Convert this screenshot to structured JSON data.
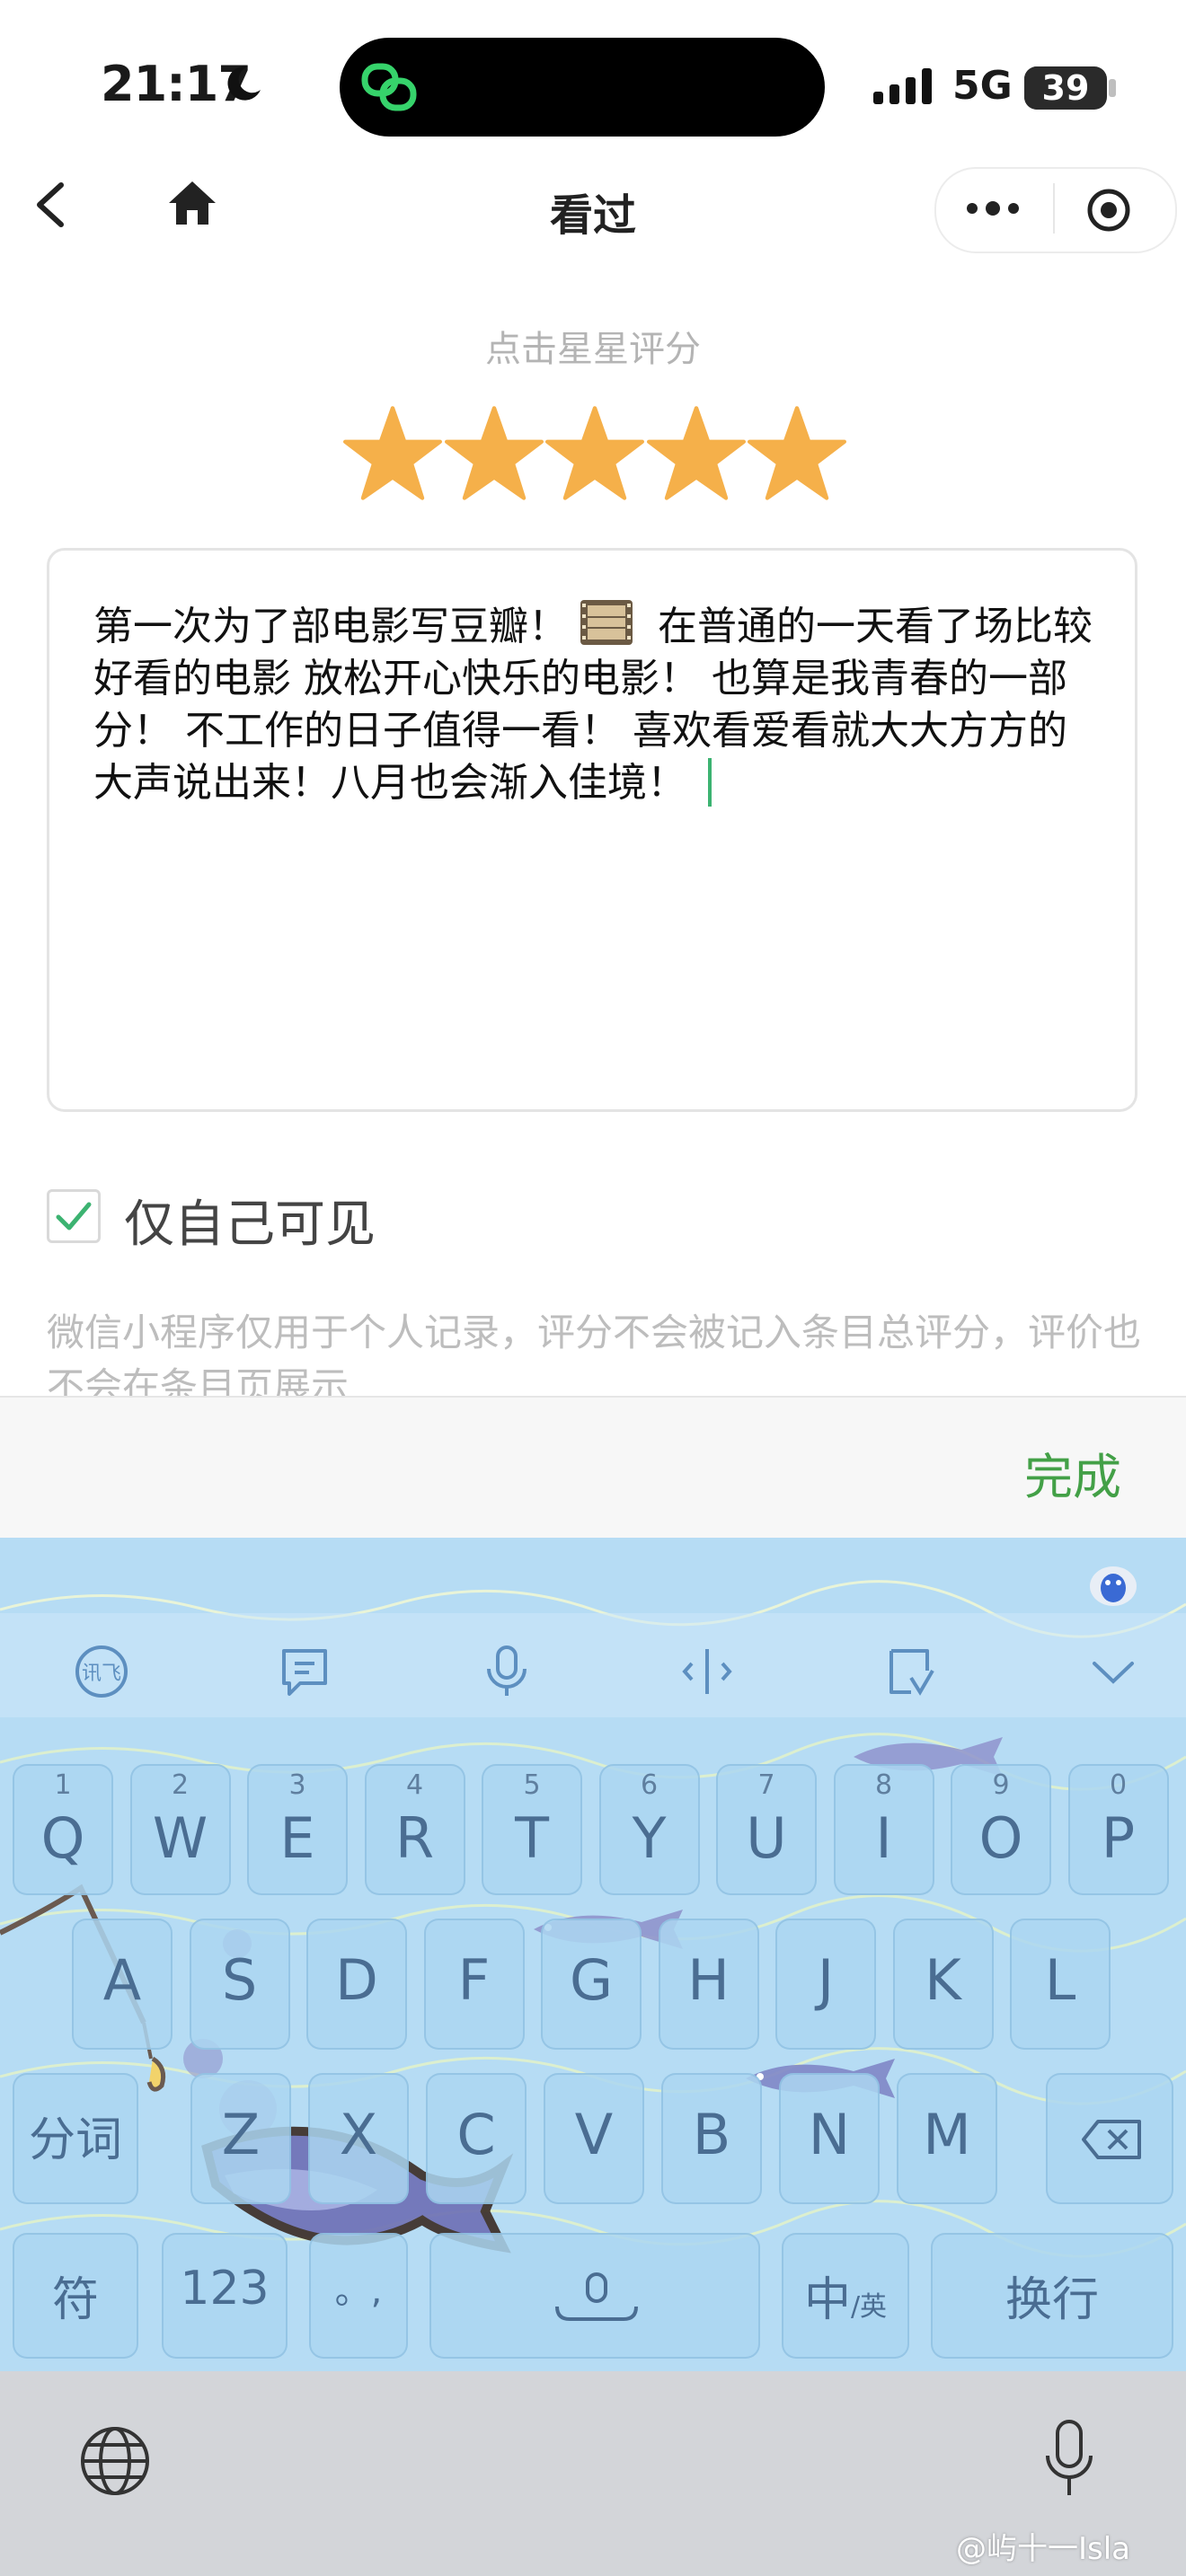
{
  "status_bar": {
    "time": "21:17",
    "network": "5G",
    "battery": "39",
    "battery_level": 0.39
  },
  "nav": {
    "title": "看过"
  },
  "rating": {
    "hint": "点击星星评分",
    "stars_filled": 5,
    "stars_total": 5,
    "star_color": "#f5b04a"
  },
  "review": {
    "text_part1": "第一次为了部电影写豆瓣！",
    "text_part2": " 在普通的一天看了场比较好看的电影 放松开心快乐的电影！ 也算是我青春的一部分！ 不工作的日子值得一看！ 喜欢看爱看就大大方方的大声说出来！八月也会渐入佳境！"
  },
  "visibility": {
    "label": "仅自己可见",
    "checked": true,
    "check_color": "#3cb371"
  },
  "notice": "微信小程序仅用于个人记录，评分不会被记入条目总评分，评价也不会在条目页展示",
  "done_bar": {
    "done_label": "完成",
    "accent": "#43a047"
  },
  "keyboard": {
    "row1": [
      {
        "num": "1",
        "letter": "Q"
      },
      {
        "num": "2",
        "letter": "W"
      },
      {
        "num": "3",
        "letter": "E"
      },
      {
        "num": "4",
        "letter": "R"
      },
      {
        "num": "5",
        "letter": "T"
      },
      {
        "num": "6",
        "letter": "Y"
      },
      {
        "num": "7",
        "letter": "U"
      },
      {
        "num": "8",
        "letter": "I"
      },
      {
        "num": "9",
        "letter": "O"
      },
      {
        "num": "0",
        "letter": "P"
      }
    ],
    "row2": [
      "A",
      "S",
      "D",
      "F",
      "G",
      "H",
      "J",
      "K",
      "L"
    ],
    "row3": [
      "Z",
      "X",
      "C",
      "V",
      "B",
      "N",
      "M"
    ],
    "segment_label": "分词",
    "symbol_label": "符",
    "numbers_label": "123",
    "punct_label": "。,",
    "lang_label_main": "中",
    "lang_label_sub": "/英",
    "return_label": "换行",
    "toolbar_icons": [
      "ifly-icon",
      "chat-bubble-icon",
      "microphone-icon",
      "cursor-icon",
      "clipboard-icon",
      "chevron-down-icon"
    ]
  },
  "watermark": "@屿十一Isla"
}
